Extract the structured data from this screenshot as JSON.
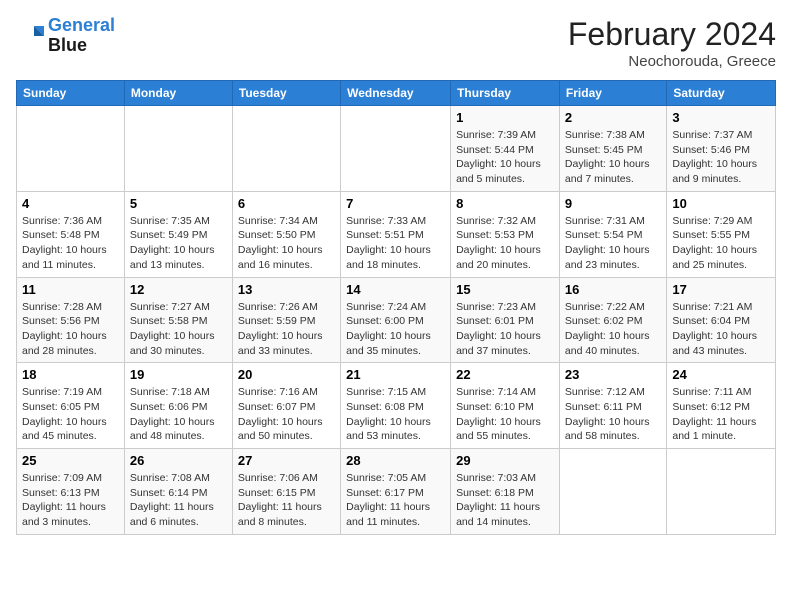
{
  "header": {
    "logo_line1": "General",
    "logo_line2": "Blue",
    "month": "February 2024",
    "location": "Neochorouda, Greece"
  },
  "weekdays": [
    "Sunday",
    "Monday",
    "Tuesday",
    "Wednesday",
    "Thursday",
    "Friday",
    "Saturday"
  ],
  "weeks": [
    [
      {
        "day": "",
        "info": ""
      },
      {
        "day": "",
        "info": ""
      },
      {
        "day": "",
        "info": ""
      },
      {
        "day": "",
        "info": ""
      },
      {
        "day": "1",
        "info": "Sunrise: 7:39 AM\nSunset: 5:44 PM\nDaylight: 10 hours and 5 minutes."
      },
      {
        "day": "2",
        "info": "Sunrise: 7:38 AM\nSunset: 5:45 PM\nDaylight: 10 hours and 7 minutes."
      },
      {
        "day": "3",
        "info": "Sunrise: 7:37 AM\nSunset: 5:46 PM\nDaylight: 10 hours and 9 minutes."
      }
    ],
    [
      {
        "day": "4",
        "info": "Sunrise: 7:36 AM\nSunset: 5:48 PM\nDaylight: 10 hours and 11 minutes."
      },
      {
        "day": "5",
        "info": "Sunrise: 7:35 AM\nSunset: 5:49 PM\nDaylight: 10 hours and 13 minutes."
      },
      {
        "day": "6",
        "info": "Sunrise: 7:34 AM\nSunset: 5:50 PM\nDaylight: 10 hours and 16 minutes."
      },
      {
        "day": "7",
        "info": "Sunrise: 7:33 AM\nSunset: 5:51 PM\nDaylight: 10 hours and 18 minutes."
      },
      {
        "day": "8",
        "info": "Sunrise: 7:32 AM\nSunset: 5:53 PM\nDaylight: 10 hours and 20 minutes."
      },
      {
        "day": "9",
        "info": "Sunrise: 7:31 AM\nSunset: 5:54 PM\nDaylight: 10 hours and 23 minutes."
      },
      {
        "day": "10",
        "info": "Sunrise: 7:29 AM\nSunset: 5:55 PM\nDaylight: 10 hours and 25 minutes."
      }
    ],
    [
      {
        "day": "11",
        "info": "Sunrise: 7:28 AM\nSunset: 5:56 PM\nDaylight: 10 hours and 28 minutes."
      },
      {
        "day": "12",
        "info": "Sunrise: 7:27 AM\nSunset: 5:58 PM\nDaylight: 10 hours and 30 minutes."
      },
      {
        "day": "13",
        "info": "Sunrise: 7:26 AM\nSunset: 5:59 PM\nDaylight: 10 hours and 33 minutes."
      },
      {
        "day": "14",
        "info": "Sunrise: 7:24 AM\nSunset: 6:00 PM\nDaylight: 10 hours and 35 minutes."
      },
      {
        "day": "15",
        "info": "Sunrise: 7:23 AM\nSunset: 6:01 PM\nDaylight: 10 hours and 37 minutes."
      },
      {
        "day": "16",
        "info": "Sunrise: 7:22 AM\nSunset: 6:02 PM\nDaylight: 10 hours and 40 minutes."
      },
      {
        "day": "17",
        "info": "Sunrise: 7:21 AM\nSunset: 6:04 PM\nDaylight: 10 hours and 43 minutes."
      }
    ],
    [
      {
        "day": "18",
        "info": "Sunrise: 7:19 AM\nSunset: 6:05 PM\nDaylight: 10 hours and 45 minutes."
      },
      {
        "day": "19",
        "info": "Sunrise: 7:18 AM\nSunset: 6:06 PM\nDaylight: 10 hours and 48 minutes."
      },
      {
        "day": "20",
        "info": "Sunrise: 7:16 AM\nSunset: 6:07 PM\nDaylight: 10 hours and 50 minutes."
      },
      {
        "day": "21",
        "info": "Sunrise: 7:15 AM\nSunset: 6:08 PM\nDaylight: 10 hours and 53 minutes."
      },
      {
        "day": "22",
        "info": "Sunrise: 7:14 AM\nSunset: 6:10 PM\nDaylight: 10 hours and 55 minutes."
      },
      {
        "day": "23",
        "info": "Sunrise: 7:12 AM\nSunset: 6:11 PM\nDaylight: 10 hours and 58 minutes."
      },
      {
        "day": "24",
        "info": "Sunrise: 7:11 AM\nSunset: 6:12 PM\nDaylight: 11 hours and 1 minute."
      }
    ],
    [
      {
        "day": "25",
        "info": "Sunrise: 7:09 AM\nSunset: 6:13 PM\nDaylight: 11 hours and 3 minutes."
      },
      {
        "day": "26",
        "info": "Sunrise: 7:08 AM\nSunset: 6:14 PM\nDaylight: 11 hours and 6 minutes."
      },
      {
        "day": "27",
        "info": "Sunrise: 7:06 AM\nSunset: 6:15 PM\nDaylight: 11 hours and 8 minutes."
      },
      {
        "day": "28",
        "info": "Sunrise: 7:05 AM\nSunset: 6:17 PM\nDaylight: 11 hours and 11 minutes."
      },
      {
        "day": "29",
        "info": "Sunrise: 7:03 AM\nSunset: 6:18 PM\nDaylight: 11 hours and 14 minutes."
      },
      {
        "day": "",
        "info": ""
      },
      {
        "day": "",
        "info": ""
      }
    ]
  ]
}
